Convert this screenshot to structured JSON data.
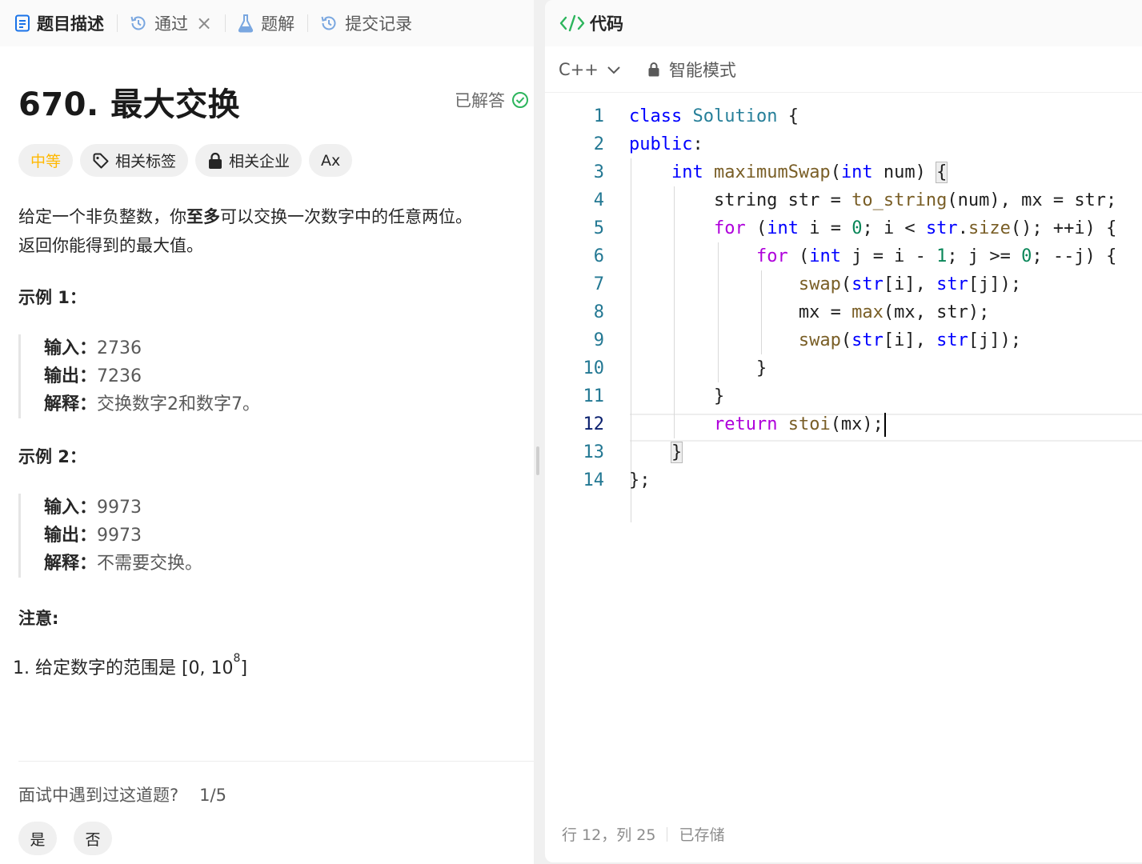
{
  "left_tabs": [
    {
      "label": "题目描述",
      "icon": "description-icon"
    },
    {
      "label": "通过",
      "icon": "history-icon",
      "close": "×"
    },
    {
      "label": "题解",
      "icon": "flask-icon"
    },
    {
      "label": "提交记录",
      "icon": "history-icon"
    }
  ],
  "problem": {
    "title": "670. 最大交换",
    "status": "已解答",
    "tags": {
      "difficulty": "中等",
      "related_tags": "相关标签",
      "related_companies": "相关企业",
      "translate": "Ax"
    },
    "description": {
      "p1_a": "给定一个非负整数，你",
      "p1_bold": "至多",
      "p1_b": "可以交换一次数字中的任意两位。",
      "p2": "返回你能得到的最大值。"
    },
    "examples": [
      {
        "title": "示例 1：",
        "input_k": "输入：",
        "input_v": "2736",
        "output_k": "输出：",
        "output_v": "7236",
        "explain_k": "解释：",
        "explain_v": "交换数字2和数字7。"
      },
      {
        "title": "示例 2：",
        "input_k": "输入：",
        "input_v": "9973",
        "output_k": "输出：",
        "output_v": "9973",
        "explain_k": "解释：",
        "explain_v": "不需要交换。"
      }
    ],
    "note_title": "注意:",
    "constraint": {
      "text": "1.  给定数字的范围是 [0, 10",
      "sup": "8",
      "end": "]"
    },
    "interview": {
      "question": "面试中遇到过这道题?",
      "count": "1/5",
      "yes": "是",
      "no": "否"
    }
  },
  "code_panel": {
    "title": "代码",
    "language": "C++",
    "mode": "智能模式",
    "status_position": "行 12，列 25",
    "status_saved": "已存储"
  },
  "code_lines": [
    "class Solution {",
    "public:",
    "    int maximumSwap(int num) {",
    "        string str = to_string(num), mx = str;",
    "        for (int i = 0; i < str.size(); ++i) {",
    "            for (int j = i - 1; j >= 0; --j) {",
    "                swap(str[i], str[j]);",
    "                mx = max(mx, str);",
    "                swap(str[i], str[j]);",
    "            }",
    "        }",
    "        return stoi(mx);",
    "    }",
    "};"
  ],
  "colors": {
    "accent_green": "#2db55d",
    "difficulty_orange": "#ffb800",
    "tab_blue": "#1a73e8"
  }
}
